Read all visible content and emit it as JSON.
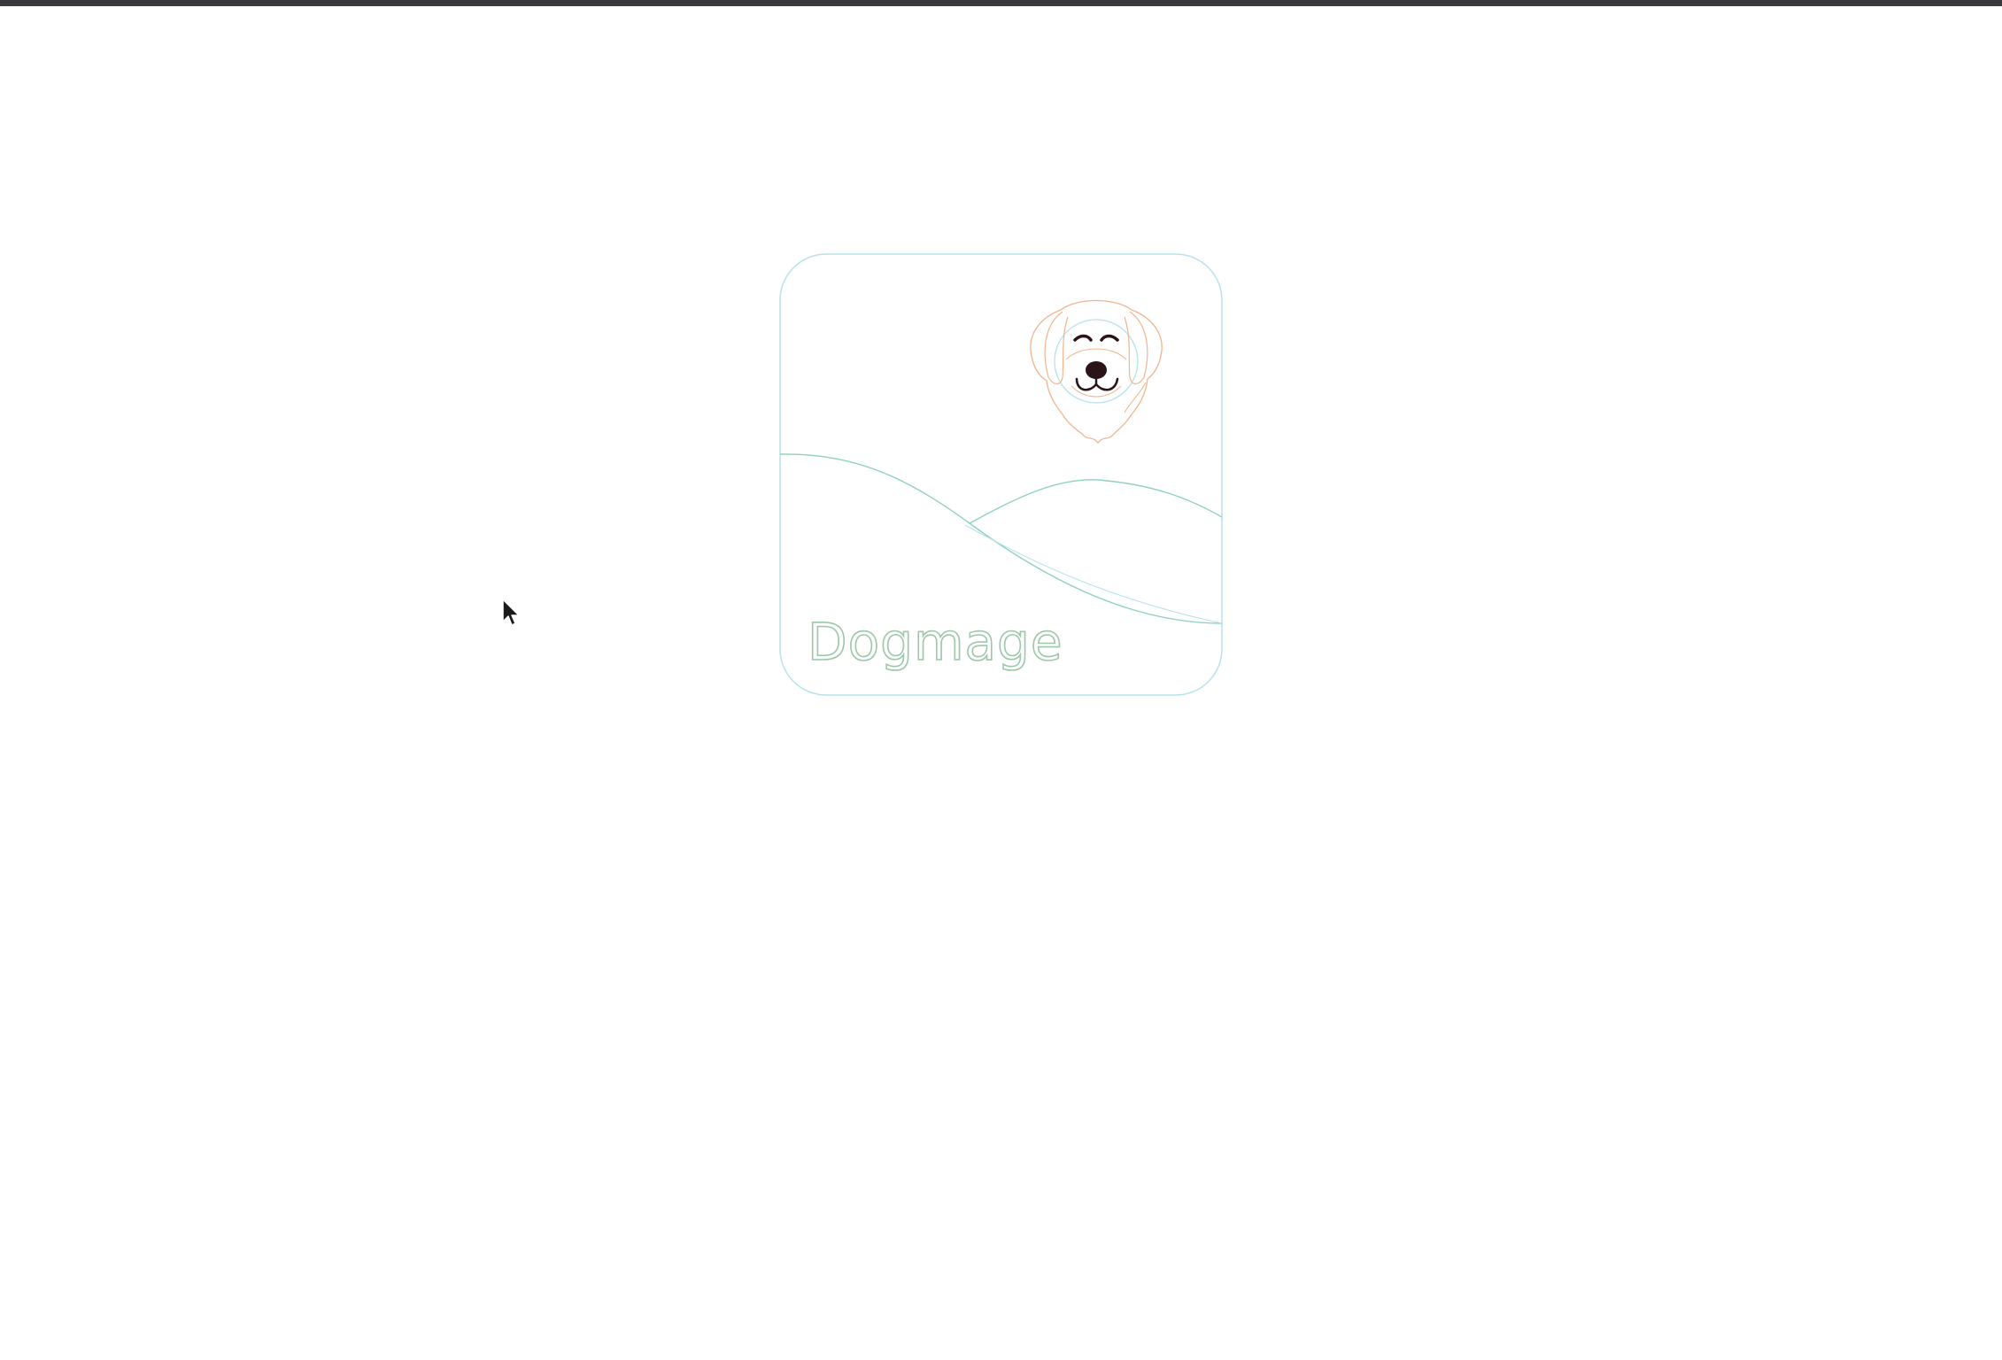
{
  "window": {
    "top_bar_color": "#3a3a3e"
  },
  "logo": {
    "wordmark": "Dogmage",
    "outline_color": "#b6e2ea",
    "hill_color": "#8fd0c0",
    "wordmark_color": "#9cc7a8",
    "dog_outline_color": "#f2b48e",
    "dog_feature_color": "#2a1418",
    "icon": "dog-head-icon"
  },
  "cursor": {
    "icon": "arrow-cursor-icon"
  }
}
